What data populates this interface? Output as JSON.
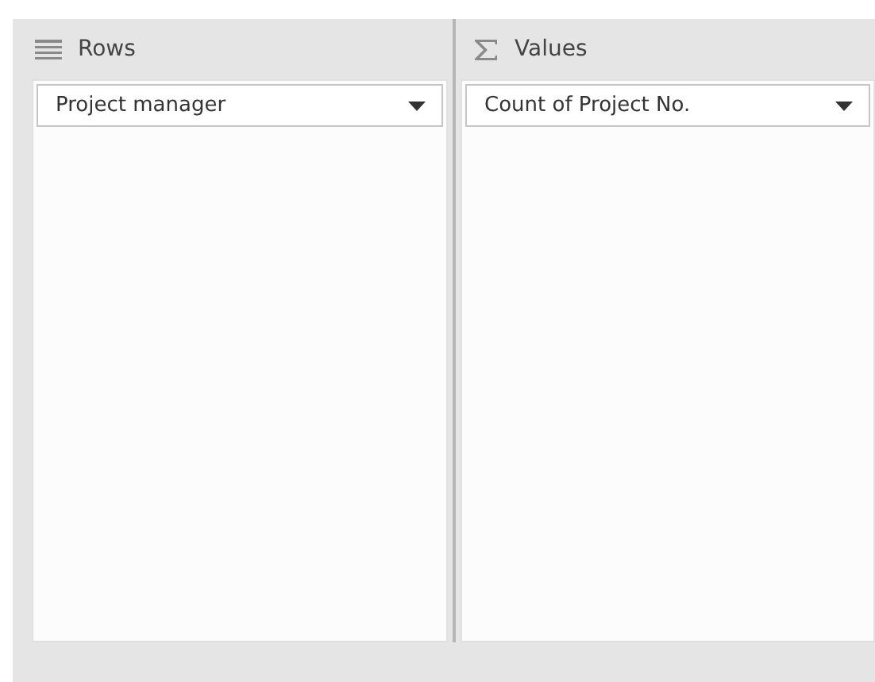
{
  "areas": [
    {
      "kind": "rows",
      "title": "Rows",
      "fields": [
        {
          "label": "Project manager"
        }
      ]
    },
    {
      "kind": "values",
      "title": "Values",
      "fields": [
        {
          "label": "Count of Project No."
        }
      ]
    }
  ]
}
